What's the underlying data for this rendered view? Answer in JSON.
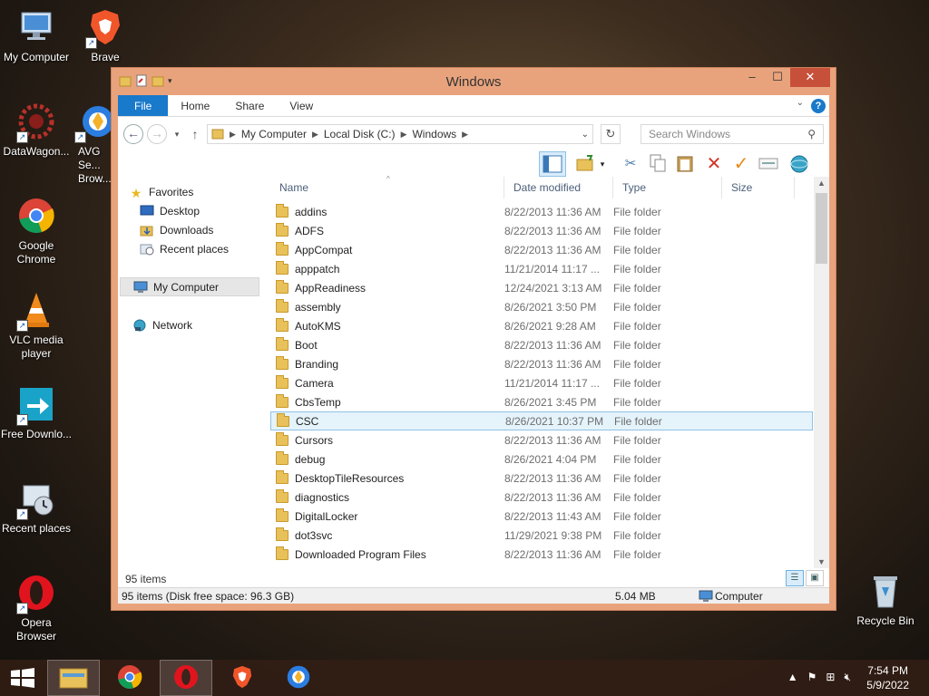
{
  "desktop": {
    "icons": [
      {
        "label": "My Computer"
      },
      {
        "label": "Brave"
      },
      {
        "label": "DataWagon..."
      },
      {
        "label": "AVG Se... Brow..."
      },
      {
        "label": "Google Chrome"
      },
      {
        "label": "VLC media player"
      },
      {
        "label": "Free Downlo..."
      },
      {
        "label": "Recent places"
      },
      {
        "label": "Opera Browser"
      },
      {
        "label": "Recycle Bin"
      }
    ]
  },
  "window": {
    "title": "Windows",
    "accent_color": "#e9a37c",
    "ribbon": {
      "tabs": [
        {
          "label": "File"
        },
        {
          "label": "Home"
        },
        {
          "label": "Share"
        },
        {
          "label": "View"
        }
      ],
      "help_label": "?"
    },
    "address": {
      "crumbs": [
        "My Computer",
        "Local Disk (C:)",
        "Windows"
      ]
    },
    "search": {
      "placeholder": "Search Windows"
    },
    "nav": {
      "favorites_label": "Favorites",
      "favorites": [
        {
          "label": "Desktop"
        },
        {
          "label": "Downloads"
        },
        {
          "label": "Recent places"
        }
      ],
      "computer_label": "My Computer",
      "network_label": "Network"
    },
    "columns": {
      "name": "Name",
      "date": "Date modified",
      "type": "Type",
      "size": "Size"
    },
    "files": [
      {
        "name": "addins",
        "date": "8/22/2013 11:36 AM",
        "type": "File folder"
      },
      {
        "name": "ADFS",
        "date": "8/22/2013 11:36 AM",
        "type": "File folder"
      },
      {
        "name": "AppCompat",
        "date": "8/22/2013 11:36 AM",
        "type": "File folder"
      },
      {
        "name": "apppatch",
        "date": "11/21/2014 11:17 ...",
        "type": "File folder"
      },
      {
        "name": "AppReadiness",
        "date": "12/24/2021 3:13 AM",
        "type": "File folder"
      },
      {
        "name": "assembly",
        "date": "8/26/2021 3:50 PM",
        "type": "File folder"
      },
      {
        "name": "AutoKMS",
        "date": "8/26/2021 9:28 AM",
        "type": "File folder"
      },
      {
        "name": "Boot",
        "date": "8/22/2013 11:36 AM",
        "type": "File folder"
      },
      {
        "name": "Branding",
        "date": "8/22/2013 11:36 AM",
        "type": "File folder"
      },
      {
        "name": "Camera",
        "date": "11/21/2014 11:17 ...",
        "type": "File folder"
      },
      {
        "name": "CbsTemp",
        "date": "8/26/2021 3:45 PM",
        "type": "File folder"
      },
      {
        "name": "CSC",
        "date": "8/26/2021 10:37 PM",
        "type": "File folder",
        "selected": true
      },
      {
        "name": "Cursors",
        "date": "8/22/2013 11:36 AM",
        "type": "File folder"
      },
      {
        "name": "debug",
        "date": "8/26/2021 4:04 PM",
        "type": "File folder"
      },
      {
        "name": "DesktopTileResources",
        "date": "8/22/2013 11:36 AM",
        "type": "File folder"
      },
      {
        "name": "diagnostics",
        "date": "8/22/2013 11:36 AM",
        "type": "File folder"
      },
      {
        "name": "DigitalLocker",
        "date": "8/22/2013 11:43 AM",
        "type": "File folder"
      },
      {
        "name": "dot3svc",
        "date": "11/29/2021 9:38 PM",
        "type": "File folder"
      },
      {
        "name": "Downloaded Program Files",
        "date": "8/22/2013 11:36 AM",
        "type": "File folder"
      }
    ],
    "item_count": "95 items",
    "status": {
      "left": "95 items (Disk free space: 96.3 GB)",
      "size": "5.04 MB",
      "location": "Computer"
    }
  },
  "taskbar": {
    "apps": [
      {
        "icon": "file-explorer-icon",
        "active": false
      },
      {
        "icon": "chrome-icon",
        "active": false
      },
      {
        "icon": "opera-icon",
        "active": true
      },
      {
        "icon": "brave-icon",
        "active": false
      },
      {
        "icon": "avg-browser-icon",
        "active": false
      }
    ],
    "time": "7:54 PM",
    "date": "5/9/2022"
  }
}
